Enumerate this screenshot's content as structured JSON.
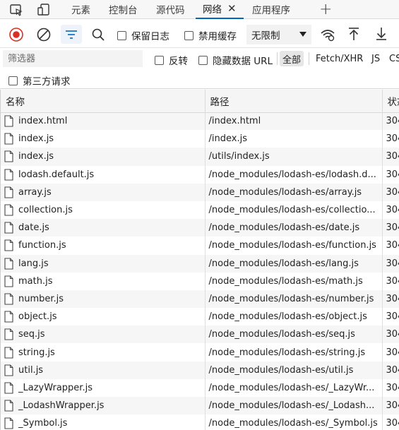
{
  "tabs": [
    {
      "label": "元素"
    },
    {
      "label": "控制台"
    },
    {
      "label": "源代码"
    },
    {
      "label": "网络",
      "close": "✕"
    },
    {
      "label": "应用程序"
    }
  ],
  "new_tab": "+",
  "toolbar": {
    "preserve_log": "保留日志",
    "disable_cache": "禁用缓存",
    "throttling": "无限制"
  },
  "filter": {
    "placeholder": "筛选器",
    "invert": "反转",
    "hide_data_urls": "隐藏数据 URL",
    "types": [
      "全部",
      "Fetch/XHR",
      "JS",
      "CSS"
    ],
    "third_party": "第三方请求"
  },
  "table": {
    "headers": {
      "name": "名称",
      "path": "路径",
      "status": "状态"
    },
    "rows": [
      {
        "name": "index.html",
        "path": "/index.html",
        "status": "304"
      },
      {
        "name": "index.js",
        "path": "/index.js",
        "status": "304"
      },
      {
        "name": "index.js",
        "path": "/utils/index.js",
        "status": "304"
      },
      {
        "name": "lodash.default.js",
        "path": "/node_modules/lodash-es/lodash.d...",
        "status": "304"
      },
      {
        "name": "array.js",
        "path": "/node_modules/lodash-es/array.js",
        "status": "304"
      },
      {
        "name": "collection.js",
        "path": "/node_modules/lodash-es/collectio...",
        "status": "304"
      },
      {
        "name": "date.js",
        "path": "/node_modules/lodash-es/date.js",
        "status": "304"
      },
      {
        "name": "function.js",
        "path": "/node_modules/lodash-es/function.js",
        "status": "304"
      },
      {
        "name": "lang.js",
        "path": "/node_modules/lodash-es/lang.js",
        "status": "304"
      },
      {
        "name": "math.js",
        "path": "/node_modules/lodash-es/math.js",
        "status": "304"
      },
      {
        "name": "number.js",
        "path": "/node_modules/lodash-es/number.js",
        "status": "304"
      },
      {
        "name": "object.js",
        "path": "/node_modules/lodash-es/object.js",
        "status": "304"
      },
      {
        "name": "seq.js",
        "path": "/node_modules/lodash-es/seq.js",
        "status": "304"
      },
      {
        "name": "string.js",
        "path": "/node_modules/lodash-es/string.js",
        "status": "304"
      },
      {
        "name": "util.js",
        "path": "/node_modules/lodash-es/util.js",
        "status": "304"
      },
      {
        "name": "_LazyWrapper.js",
        "path": "/node_modules/lodash-es/_LazyWr...",
        "status": "304"
      },
      {
        "name": "_LodashWrapper.js",
        "path": "/node_modules/lodash-es/_Lodash...",
        "status": "304"
      },
      {
        "name": "_Symbol.js",
        "path": "/node_modules/lodash-es/_Symbol.js",
        "status": "304"
      }
    ]
  },
  "colors": {
    "record_red": "#d93025",
    "active_blue": "#0067c0"
  },
  "icons": [
    "inspect-icon",
    "device-toolbar-icon",
    "record-icon",
    "clear-icon",
    "filter-icon",
    "search-icon",
    "dropdown-arrow-icon",
    "network-conditions-icon",
    "upload-icon",
    "download-icon",
    "file-icon"
  ]
}
